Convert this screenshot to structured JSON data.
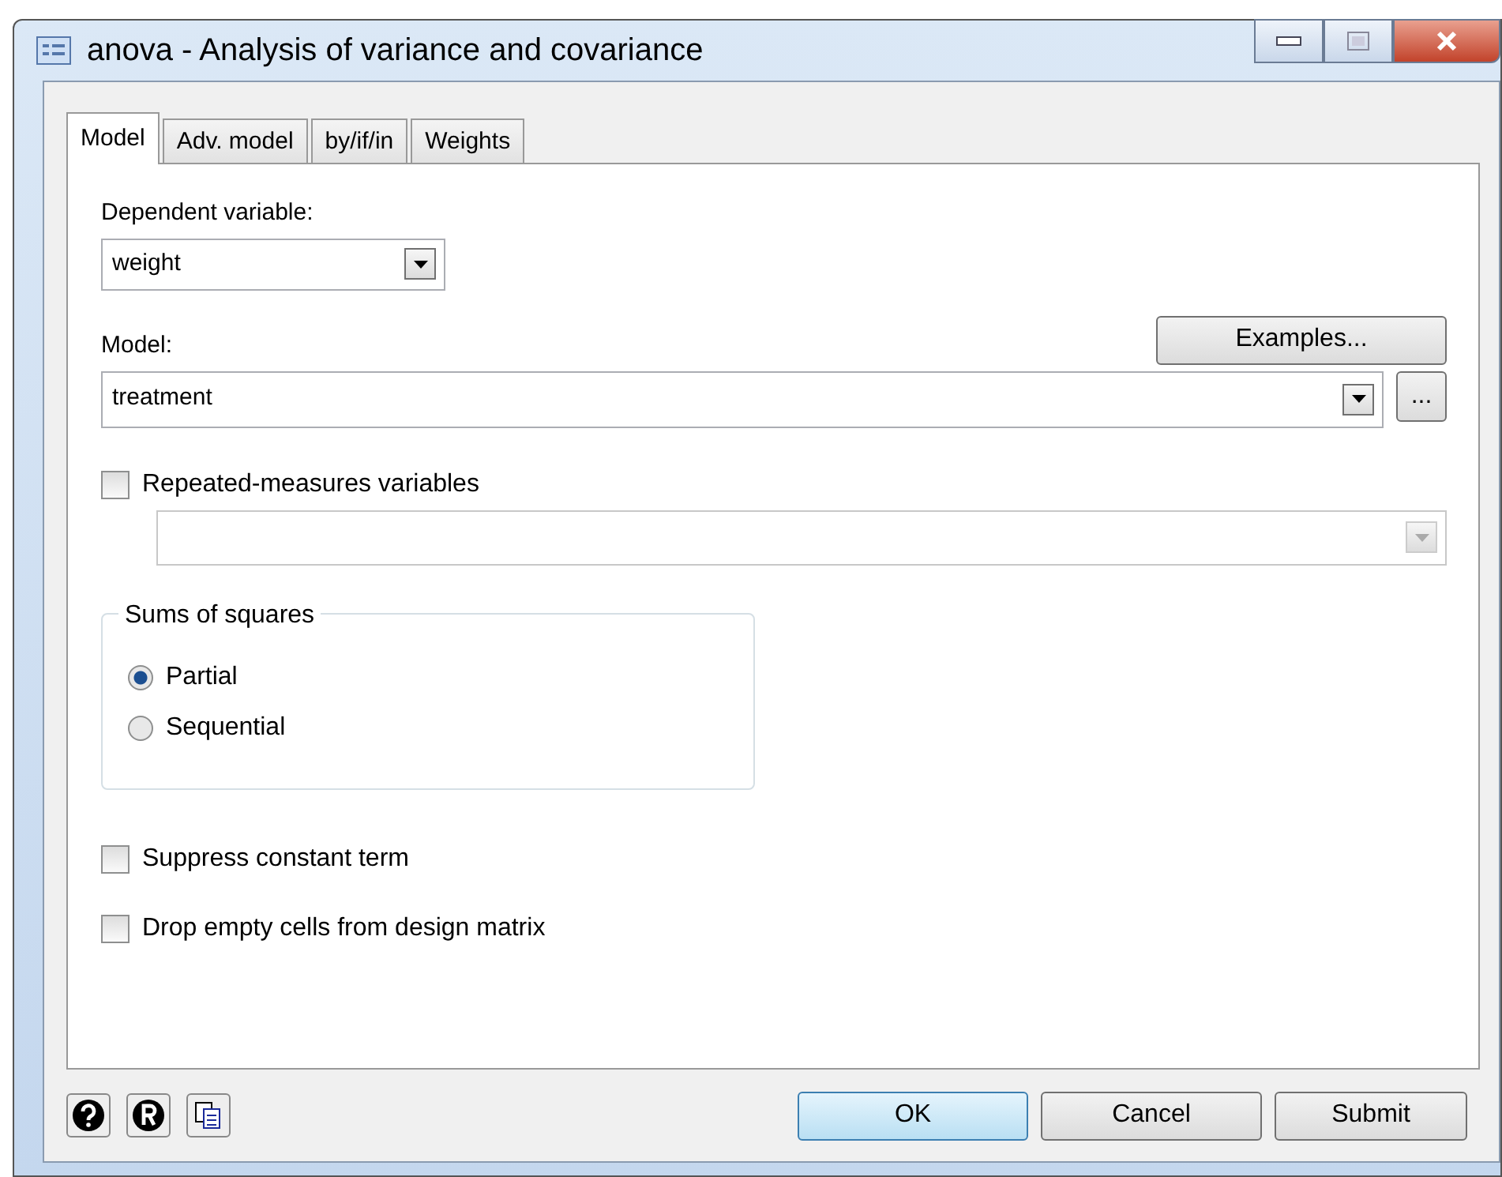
{
  "window": {
    "title": "anova - Analysis of variance and covariance"
  },
  "tabs": [
    {
      "label": "Model",
      "selected": true
    },
    {
      "label": "Adv. model",
      "selected": false
    },
    {
      "label": "by/if/in",
      "selected": false
    },
    {
      "label": "Weights",
      "selected": false
    }
  ],
  "dependent_variable": {
    "label": "Dependent variable:",
    "value": "weight"
  },
  "model": {
    "label": "Model:",
    "value": "treatment",
    "examples_button": "Examples...",
    "browse_button": "..."
  },
  "repeated_measures": {
    "label": "Repeated-measures variables",
    "checked": false,
    "field_disabled": true
  },
  "sums_of_squares": {
    "title": "Sums of squares",
    "options": [
      {
        "label": "Partial",
        "selected": true
      },
      {
        "label": "Sequential",
        "selected": false
      }
    ]
  },
  "options": [
    {
      "label": "Suppress constant term",
      "checked": false
    },
    {
      "label": "Drop empty cells from design matrix",
      "checked": false
    }
  ],
  "buttons": [
    "OK",
    "Cancel",
    "Submit"
  ]
}
